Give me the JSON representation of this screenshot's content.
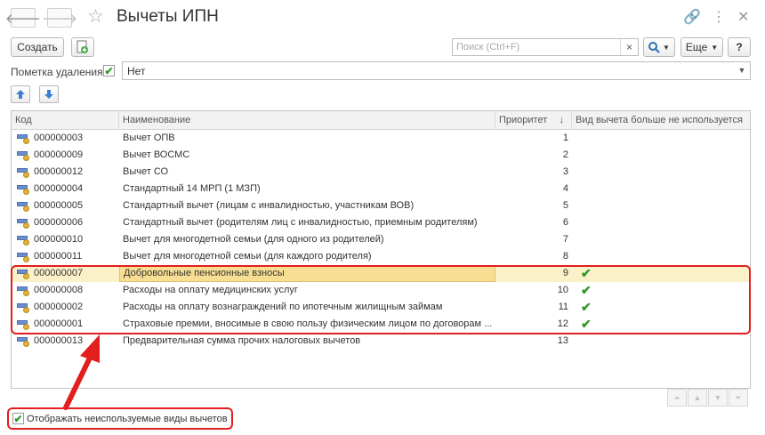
{
  "window": {
    "title": "Вычеты ИПН",
    "back_icon": "arrow-left-icon",
    "forward_icon": "arrow-right-icon"
  },
  "toolbar": {
    "create_label": "Создать",
    "search_placeholder": "Поиск (Ctrl+F)",
    "search_clear": "×",
    "more_label": "Еще",
    "help_label": "?"
  },
  "filter": {
    "label": "Пометка удаления:",
    "checked": true,
    "value": "Нет"
  },
  "table": {
    "columns": [
      "Код",
      "Наименование",
      "Приоритет",
      "Вид вычета больше не используется"
    ],
    "sort_indicator": "↓",
    "rows": [
      {
        "code": "000000003",
        "name": "Вычет ОПВ",
        "priority": "1",
        "unused": ""
      },
      {
        "code": "000000009",
        "name": "Вычет ВОСМС",
        "priority": "2",
        "unused": ""
      },
      {
        "code": "000000012",
        "name": "Вычет СО",
        "priority": "3",
        "unused": ""
      },
      {
        "code": "000000004",
        "name": "Стандартный 14 МРП (1 МЗП)",
        "priority": "4",
        "unused": ""
      },
      {
        "code": "000000005",
        "name": "Стандартный вычет (лицам с инвалидностью, участникам ВОВ)",
        "priority": "5",
        "unused": ""
      },
      {
        "code": "000000006",
        "name": "Стандартный вычет (родителям лиц с инвалидностью, приемным родителям)",
        "priority": "6",
        "unused": ""
      },
      {
        "code": "000000010",
        "name": "Вычет для многодетной семьи (для одного из родителей)",
        "priority": "7",
        "unused": ""
      },
      {
        "code": "000000011",
        "name": "Вычет для многодетной семьи (для каждого родителя)",
        "priority": "8",
        "unused": ""
      },
      {
        "code": "000000007",
        "name": "Добровольные пенсионные взносы",
        "priority": "9",
        "unused": "✔"
      },
      {
        "code": "000000008",
        "name": "Расходы на оплату медицинских услуг",
        "priority": "10",
        "unused": "✔"
      },
      {
        "code": "000000002",
        "name": "Расходы на оплату вознаграждений по ипотечным жилищным займам",
        "priority": "11",
        "unused": "✔"
      },
      {
        "code": "000000001",
        "name": "Страховые премии, вносимые в свою пользу физическим лицом по договорам ...",
        "priority": "12",
        "unused": "✔"
      },
      {
        "code": "000000013",
        "name": "Предварительная сумма прочих налоговых вычетов",
        "priority": "13",
        "unused": ""
      }
    ]
  },
  "footer": {
    "show_unused_label": "Отображать неиспользуемые виды вычетов",
    "show_unused_checked": true
  },
  "colors": {
    "accent_red": "#e31e1e",
    "check_green": "#2e9a2e",
    "selected_row": "#fbf1c8"
  }
}
